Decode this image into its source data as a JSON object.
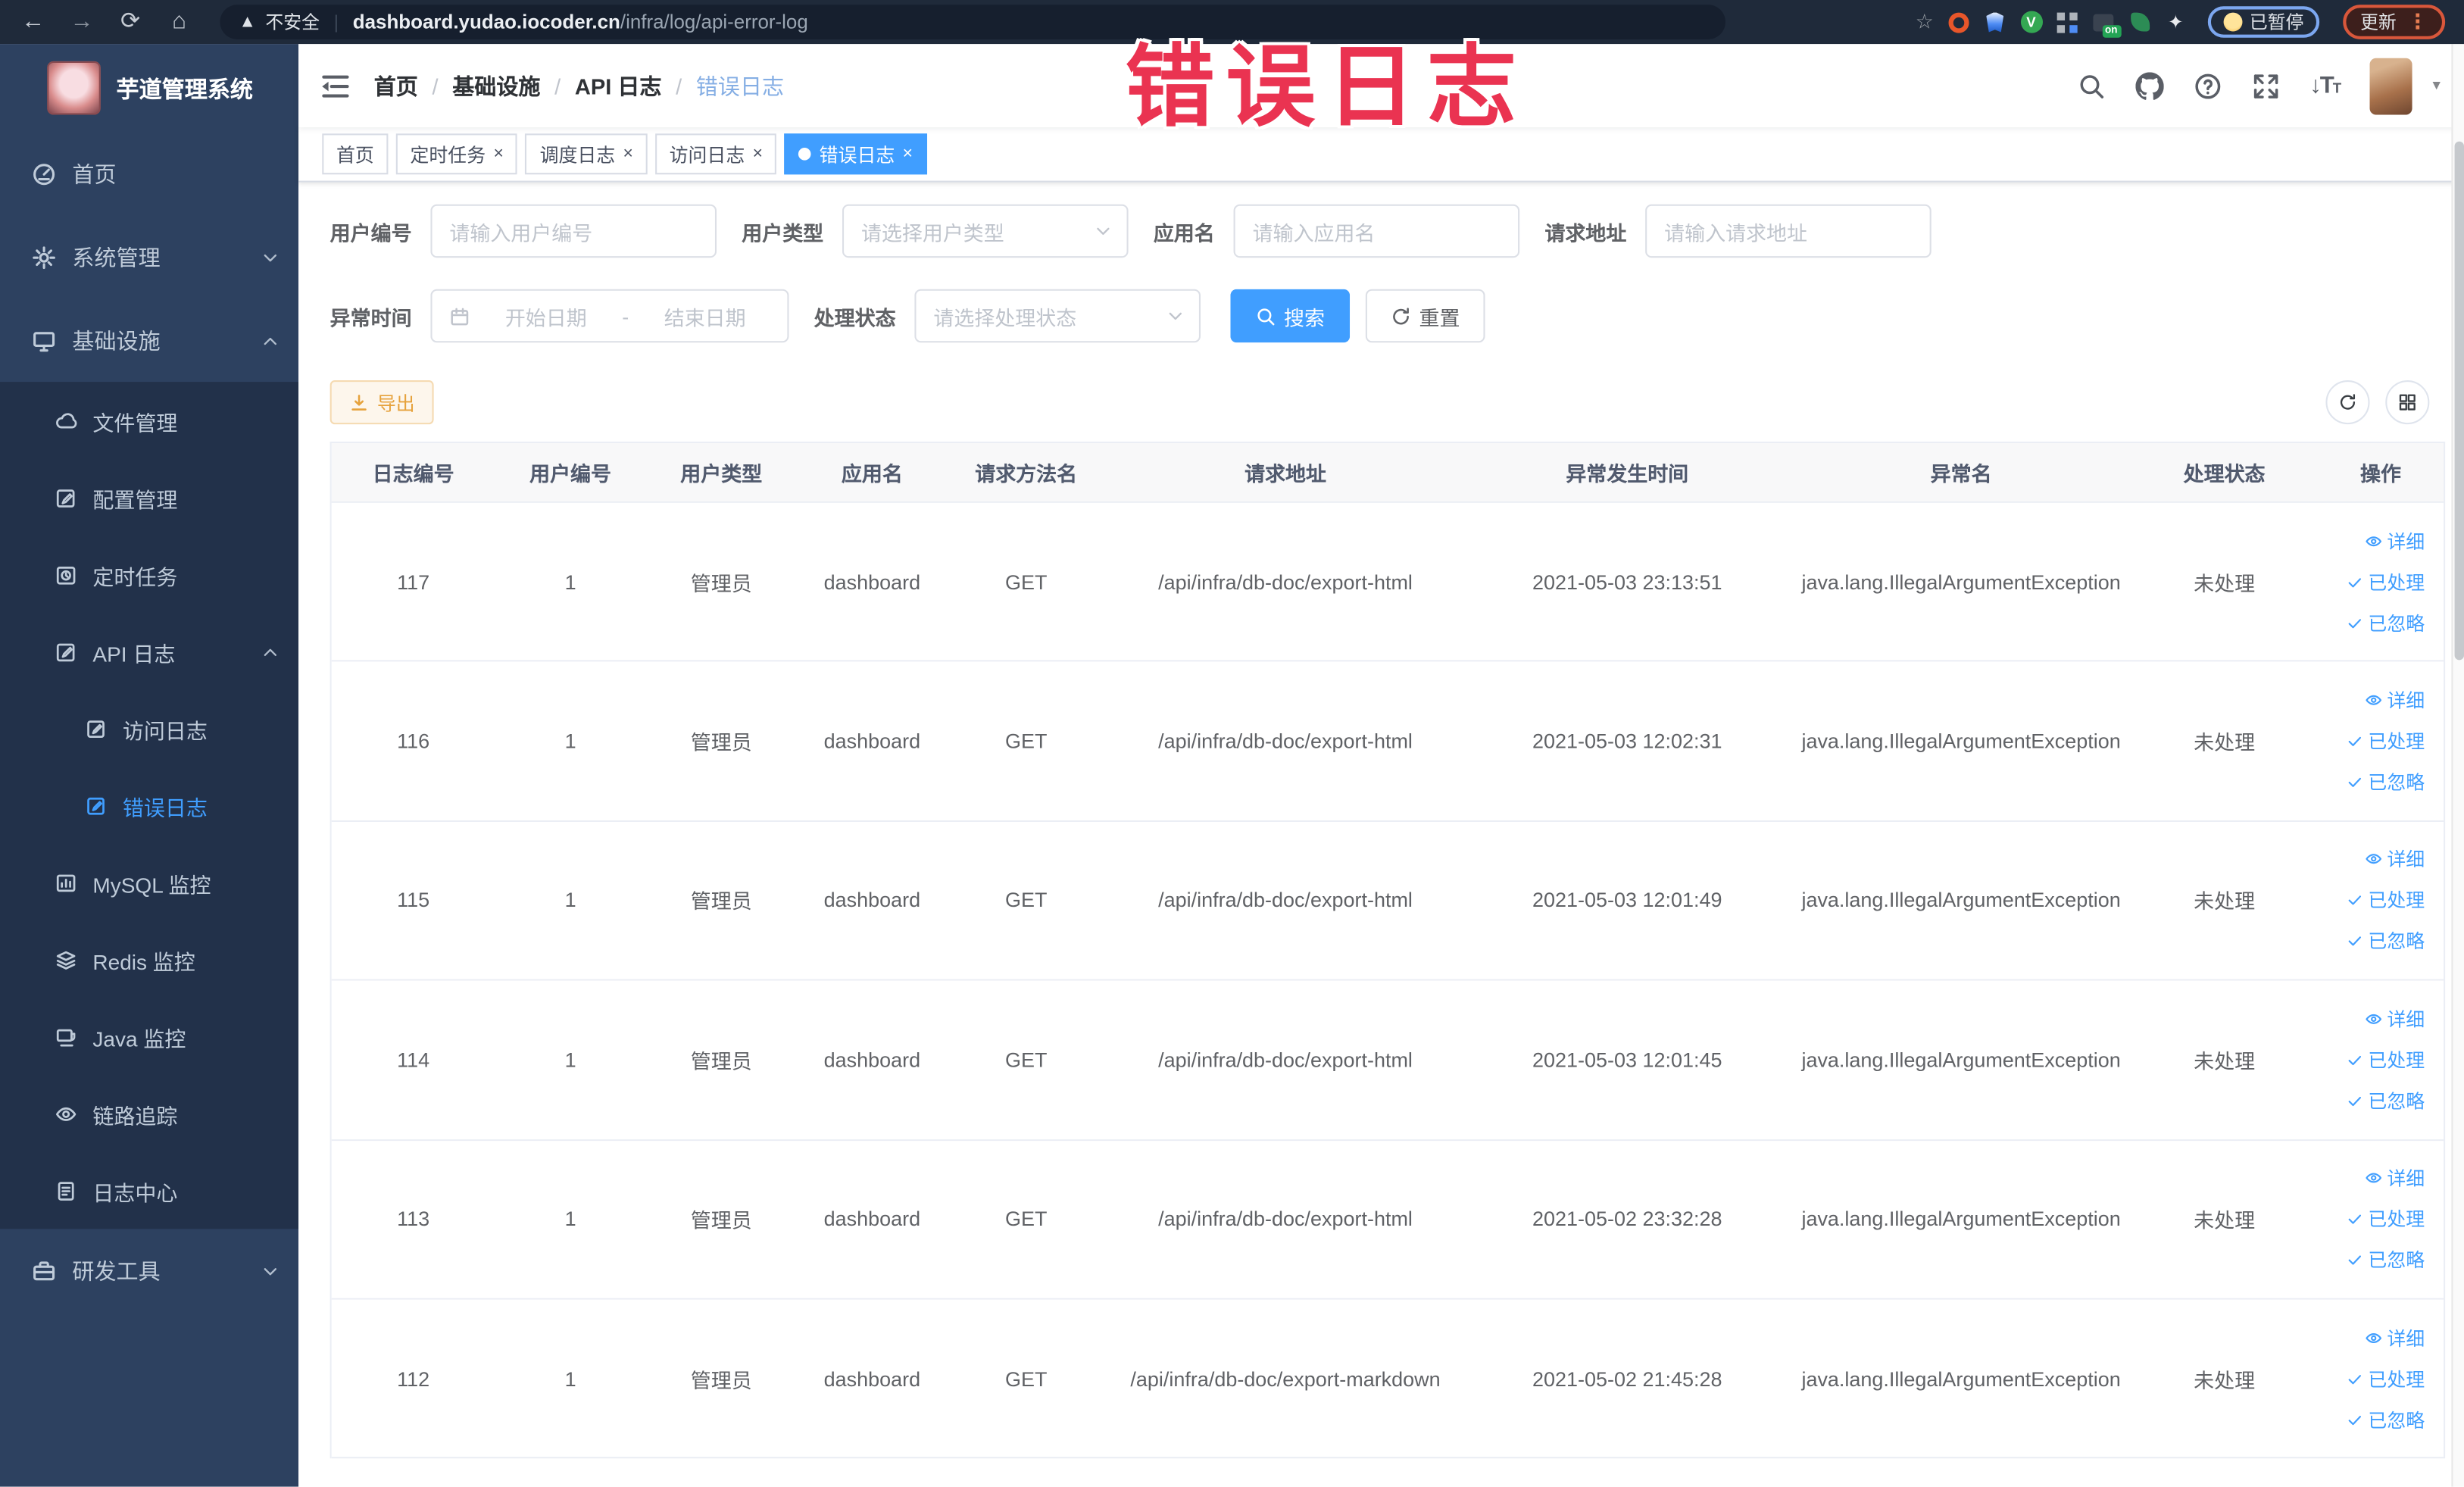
{
  "watermark": "错误日志",
  "browser": {
    "security_label": "不安全",
    "url_domain": "dashboard.yudao.iocoder.cn",
    "url_path": "/infra/log/api-error-log",
    "extension_badge": "on",
    "paused_badge": "已暂停",
    "update_button": "更新"
  },
  "sidebar": {
    "app_title": "芋道管理系统",
    "menu": [
      {
        "label": "首页",
        "icon": "dashboard-icon",
        "level": 1
      },
      {
        "label": "系统管理",
        "icon": "gear-icon",
        "level": 1,
        "chevron": "down"
      },
      {
        "label": "基础设施",
        "icon": "monitor-icon",
        "level": 1,
        "chevron": "up"
      },
      {
        "label": "文件管理",
        "icon": "cloud-icon",
        "level": 2,
        "group": "sub"
      },
      {
        "label": "配置管理",
        "icon": "edit-icon",
        "level": 2,
        "group": "sub"
      },
      {
        "label": "定时任务",
        "icon": "timer-icon",
        "level": 2,
        "group": "sub"
      },
      {
        "label": "API 日志",
        "icon": "log-icon",
        "level": 2,
        "group": "sub",
        "chevron": "up"
      },
      {
        "label": "访问日志",
        "icon": "doc-icon",
        "level": 3,
        "group": "sub"
      },
      {
        "label": "错误日志",
        "icon": "doc-icon",
        "level": 3,
        "group": "sub",
        "active": true
      },
      {
        "label": "MySQL 监控",
        "icon": "chart-icon",
        "level": 2,
        "group": "sub"
      },
      {
        "label": "Redis 监控",
        "icon": "layers-icon",
        "level": 2,
        "group": "sub"
      },
      {
        "label": "Java 监控",
        "icon": "java-icon",
        "level": 2,
        "group": "sub"
      },
      {
        "label": "链路追踪",
        "icon": "eye-icon",
        "level": 2,
        "group": "sub"
      },
      {
        "label": "日志中心",
        "icon": "logcenter-icon",
        "level": 2,
        "group": "sub"
      },
      {
        "label": "研发工具",
        "icon": "tool-icon",
        "level": 1,
        "chevron": "down"
      }
    ]
  },
  "header": {
    "breadcrumb": [
      "首页",
      "基础设施",
      "API 日志",
      "错误日志"
    ]
  },
  "tabs": [
    {
      "label": "首页"
    },
    {
      "label": "定时任务",
      "closable": true
    },
    {
      "label": "调度日志",
      "closable": true
    },
    {
      "label": "访问日志",
      "closable": true
    },
    {
      "label": "错误日志",
      "closable": true,
      "active": true
    }
  ],
  "filters": {
    "fields": [
      {
        "label": "用户编号",
        "placeholder": "请输入用户编号",
        "type": "input"
      },
      {
        "label": "用户类型",
        "placeholder": "请选择用户类型",
        "type": "select"
      },
      {
        "label": "应用名",
        "placeholder": "请输入应用名",
        "type": "input"
      },
      {
        "label": "请求地址",
        "placeholder": "请输入请求地址",
        "type": "input"
      }
    ],
    "date_field": {
      "label": "异常时间",
      "start_placeholder": "开始日期",
      "separator": "-",
      "end_placeholder": "结束日期"
    },
    "status_field": {
      "label": "处理状态",
      "placeholder": "请选择处理状态"
    },
    "search_label": "搜索",
    "reset_label": "重置"
  },
  "toolbar": {
    "export_label": "导出"
  },
  "table": {
    "columns": [
      "日志编号",
      "用户编号",
      "用户类型",
      "应用名",
      "请求方法名",
      "请求地址",
      "异常发生时间",
      "异常名",
      "处理状态",
      "操作"
    ],
    "row_actions": [
      "详细",
      "已处理",
      "已忽略"
    ],
    "rows": [
      [
        "117",
        "1",
        "管理员",
        "dashboard",
        "GET",
        "/api/infra/db-doc/export-html",
        "2021-05-03 23:13:51",
        "java.lang.IllegalArgumentException",
        "未处理"
      ],
      [
        "116",
        "1",
        "管理员",
        "dashboard",
        "GET",
        "/api/infra/db-doc/export-html",
        "2021-05-03 12:02:31",
        "java.lang.IllegalArgumentException",
        "未处理"
      ],
      [
        "115",
        "1",
        "管理员",
        "dashboard",
        "GET",
        "/api/infra/db-doc/export-html",
        "2021-05-03 12:01:49",
        "java.lang.IllegalArgumentException",
        "未处理"
      ],
      [
        "114",
        "1",
        "管理员",
        "dashboard",
        "GET",
        "/api/infra/db-doc/export-html",
        "2021-05-03 12:01:45",
        "java.lang.IllegalArgumentException",
        "未处理"
      ],
      [
        "113",
        "1",
        "管理员",
        "dashboard",
        "GET",
        "/api/infra/db-doc/export-html",
        "2021-05-02 23:32:28",
        "java.lang.IllegalArgumentException",
        "未处理"
      ],
      [
        "112",
        "1",
        "管理员",
        "dashboard",
        "GET",
        "/api/infra/db-doc/export-markdown",
        "2021-05-02 21:45:28",
        "java.lang.IllegalArgumentException",
        "未处理"
      ]
    ]
  },
  "colors": {
    "accent": "#409eff",
    "export_text": "#e6a23c",
    "watermark_red": "#ea3351",
    "sidebar_bg": "#2d4160",
    "submenu_bg": "#22314a",
    "toolbar_dark": "#1f2a3a"
  }
}
